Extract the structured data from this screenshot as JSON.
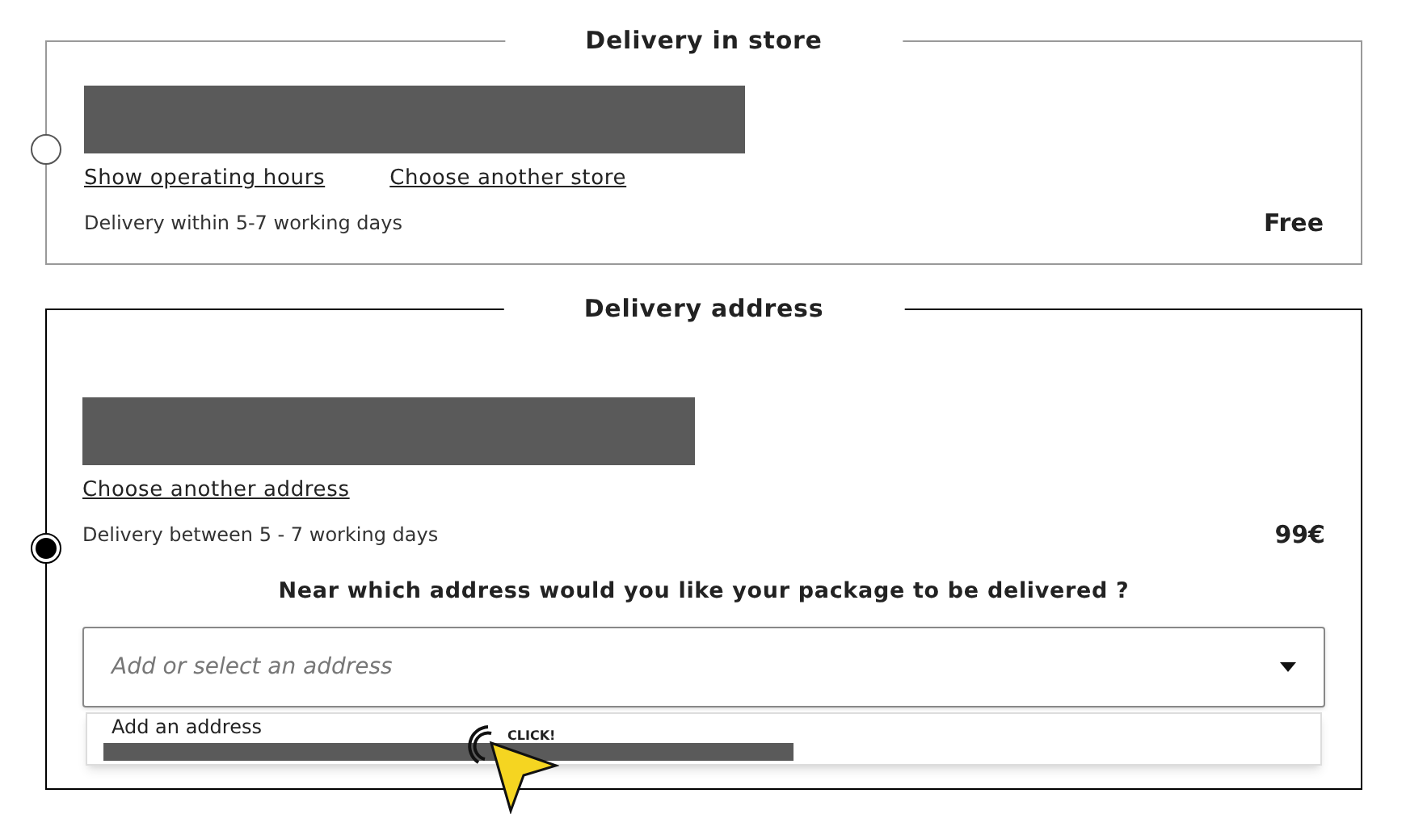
{
  "options": [
    {
      "kind": "store",
      "title": "Delivery in store",
      "selected": false,
      "links": [
        "Show operating hours",
        "Choose another store"
      ],
      "delivery_time": "Delivery within 5-7 working days",
      "price": "Free"
    },
    {
      "kind": "address",
      "title": "Delivery address",
      "selected": true,
      "links": [
        "Choose another address"
      ],
      "delivery_time": "Delivery between 5 - 7 working days",
      "price": "99€",
      "question": "Near which address would you like your package to be delivered ?",
      "select": {
        "placeholder": "Add or select an address",
        "expanded": true,
        "options": [
          "Add an address"
        ]
      }
    }
  ],
  "cursor": {
    "label": "CLICK!"
  }
}
